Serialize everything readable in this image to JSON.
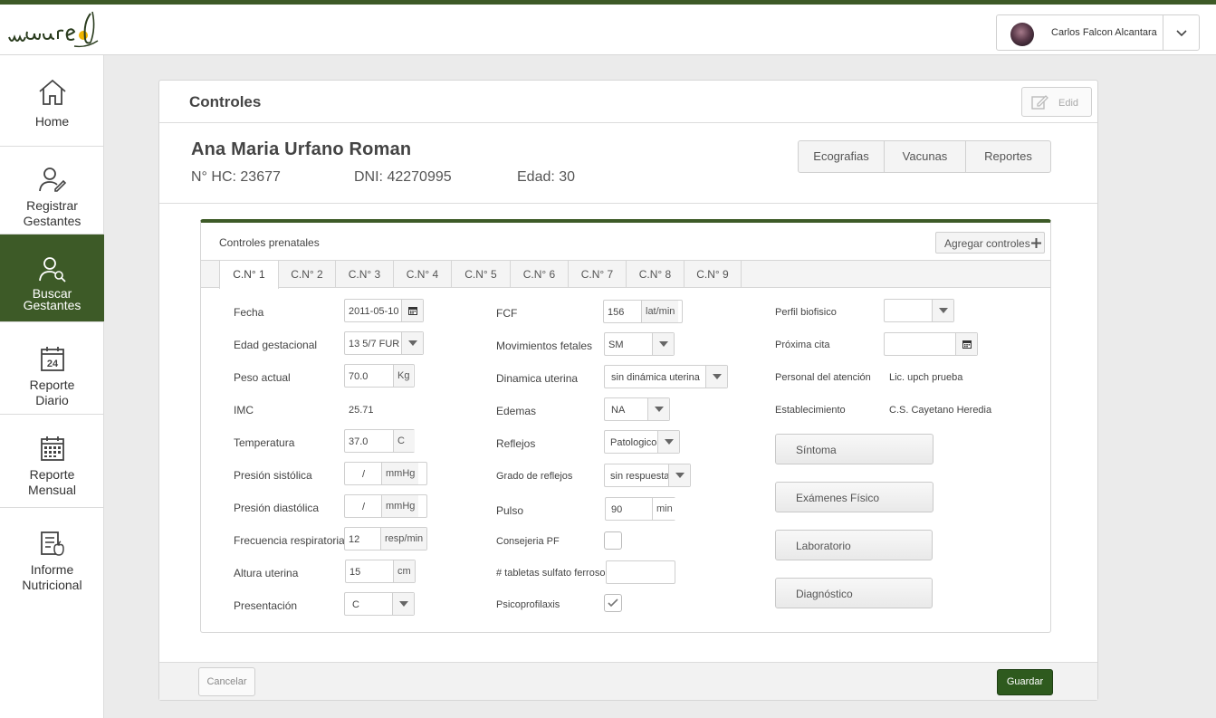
{
  "header": {
    "logo_text": "wawared",
    "user_name": "Carlos Falcon Alcantara"
  },
  "sidebar": {
    "items": [
      {
        "line1": "Home",
        "line2": ""
      },
      {
        "line1": "Registrar",
        "line2": "Gestantes"
      },
      {
        "line1": "Buscar",
        "line2": "Gestantes"
      },
      {
        "line1": "Reporte",
        "line2": "Diario"
      },
      {
        "line1": "Reporte",
        "line2": "Mensual"
      },
      {
        "line1": "Informe",
        "line2": "Nutricional"
      }
    ],
    "calendar_day": "24"
  },
  "card": {
    "title": "Controles",
    "edit_label": "Edid"
  },
  "patient": {
    "name": "Ana Maria Urfano Roman",
    "hc": "N° HC: 23677",
    "dni": "DNI: 42270995",
    "age": "Edad: 30"
  },
  "segments": [
    "Ecografias",
    "Vacunas",
    "Reportes"
  ],
  "controls": {
    "title": "Controles prenatales",
    "add_label": "Agregar controles",
    "tabs": [
      "C.N° 1",
      "C.N° 2",
      "C.N° 3",
      "C.N° 4",
      "C.N° 5",
      "C.N° 6",
      "C.N° 7",
      "C.N° 8",
      "C.N° 9"
    ]
  },
  "col1": {
    "fecha_label": "Fecha",
    "fecha_value": "2011-05-10",
    "edad_label": "Edad gestacional",
    "edad_value": "13 5/7 FUR",
    "peso_label": "Peso actual",
    "peso_value": "70.0",
    "peso_unit": "Kg",
    "imc_label": "IMC",
    "imc_value": "25.71",
    "temp_label": "Temperatura",
    "temp_value": "37.0",
    "temp_unit": "C",
    "sist_label": "Presión sistólica",
    "sist_value": "/",
    "sist_unit": "mmHg",
    "diast_label": "Presión diastólica",
    "diast_value": "/",
    "diast_unit": "mmHg",
    "resp_label": "Frecuencia respiratoria",
    "resp_value": "12",
    "resp_unit": "resp/min",
    "altura_label": "Altura uterina",
    "altura_value": "15",
    "altura_unit": "cm",
    "pres_label": "Presentación",
    "pres_value": "C"
  },
  "col2": {
    "fcf_label": "FCF",
    "fcf_value": "156",
    "fcf_unit": "lat/min",
    "mov_label": "Movimientos fetales",
    "mov_value": "SM",
    "din_label": "Dinamica uterina",
    "din_value": "sin dinámica uterina",
    "ede_label": "Edemas",
    "ede_value": "NA",
    "ref_label": "Reflejos",
    "ref_value": "Patologico",
    "grado_label": "Grado de reflejos",
    "grado_value": "sin respuesta",
    "pulso_label": "Pulso",
    "pulso_value": "90",
    "pulso_unit": "min",
    "cons_label": "Consejeria PF",
    "cons_checked": false,
    "tab_label": "# tabletas sulfato ferroso",
    "tab_value": "",
    "psico_label": "Psicoprofilaxis",
    "psico_checked": true
  },
  "col3": {
    "perfil_label": "Perfil biofisico",
    "perfil_value": "",
    "cita_label": "Próxima cita",
    "cita_value": "",
    "personal_label": "Personal del atención",
    "personal_value": "Lic. upch prueba",
    "estab_label": "Establecimiento",
    "estab_value": "C.S. Cayetano Heredia",
    "buttons": [
      "Síntoma",
      "Exámenes Físico",
      "Laboratorio",
      "Diagnóstico"
    ]
  },
  "footer": {
    "cancel_label": "Cancelar",
    "save_label": "Guardar"
  },
  "colors": {
    "brand_green": "#3d5a27",
    "save_green": "#2e5a1e"
  }
}
